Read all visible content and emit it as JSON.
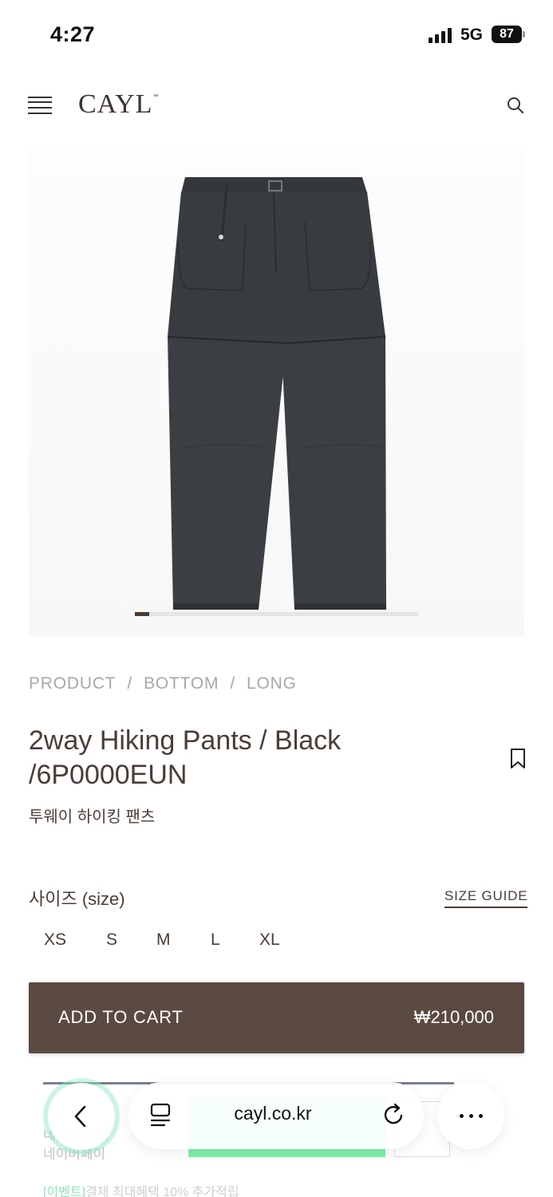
{
  "status_bar": {
    "time": "4:27",
    "network": "5G",
    "battery": "87"
  },
  "header": {
    "logo": "CAYL",
    "logo_mark": "™"
  },
  "product": {
    "carousel": {
      "current": 1,
      "total": 20
    },
    "breadcrumb": [
      "PRODUCT",
      "BOTTOM",
      "LONG"
    ],
    "breadcrumb_separator": "/",
    "title_line1": "2way Hiking Pants / Black",
    "title_line2": "/6P0000EUN",
    "subtitle_korean": "투웨이 하이킹 팬츠",
    "size_label": "사이즈 (size)",
    "size_guide": "SIZE GUIDE",
    "sizes": [
      "XS",
      "S",
      "M",
      "L",
      "XL"
    ],
    "add_to_cart_label": "ADD TO CART",
    "price": "₩210,000"
  },
  "background_content": {
    "npay_left_line1": "네이버 간편",
    "npay_left_line2": "네이버페이",
    "event_prefix": "[이벤트]",
    "event_text": "결제 최대혜택 10% 추가적립"
  },
  "browser": {
    "url": "cayl.co.kr"
  },
  "icons": {
    "menu": "menu-icon",
    "search": "search-icon",
    "bookmark": "bookmark-icon",
    "back": "chevron-left-icon",
    "reader": "reader-icon",
    "reload": "reload-icon",
    "more": "more-icon"
  },
  "colors": {
    "brand_brown": "#5a4a42",
    "text_brown": "#4a3d36",
    "npay_green": "#7cf0a8"
  }
}
